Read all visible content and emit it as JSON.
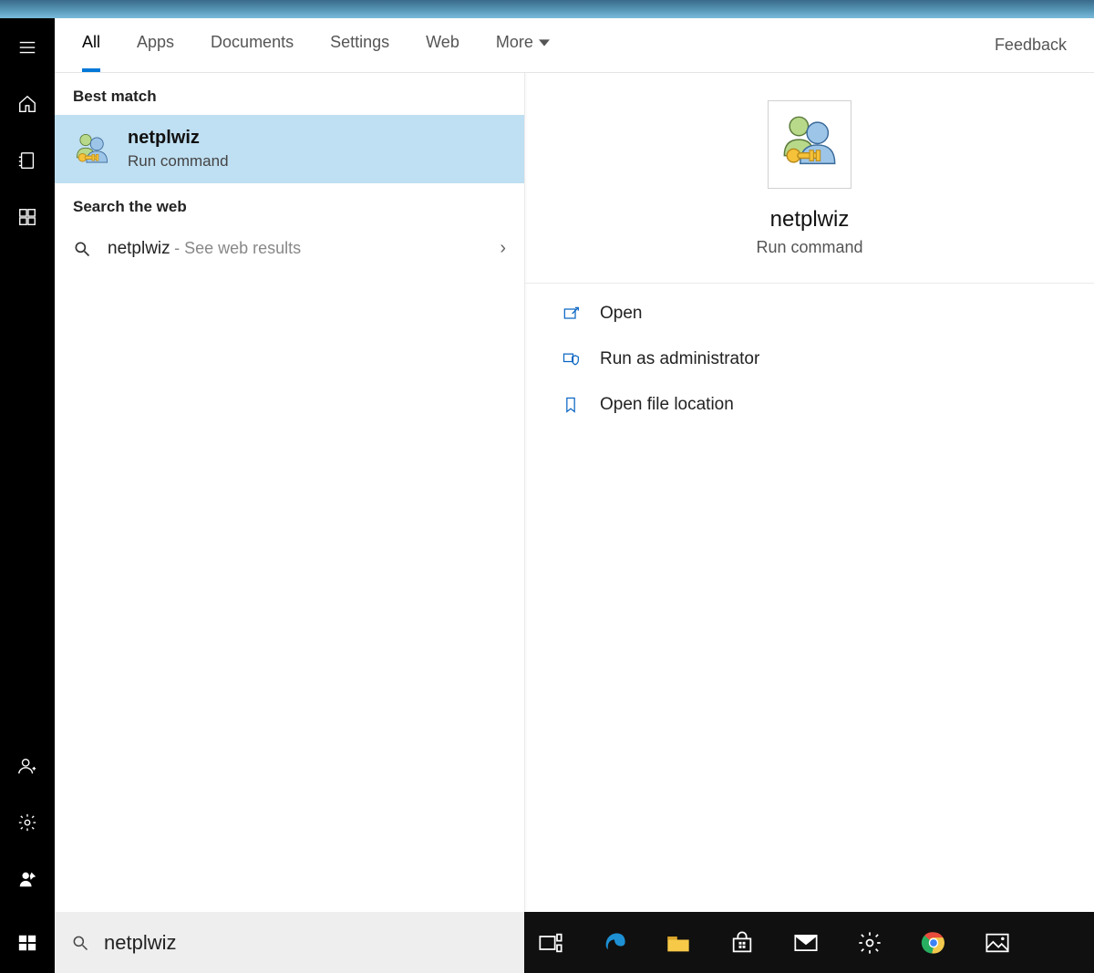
{
  "tabs": {
    "items": [
      "All",
      "Apps",
      "Documents",
      "Settings",
      "Web",
      "More"
    ],
    "feedback": "Feedback"
  },
  "sections": {
    "best_match": "Best match",
    "search_web": "Search the web"
  },
  "best_match": {
    "title": "netplwiz",
    "subtitle": "Run command"
  },
  "web_result": {
    "term": "netplwiz",
    "suffix": "- See web results"
  },
  "detail": {
    "title": "netplwiz",
    "subtitle": "Run command",
    "actions": {
      "open": "Open",
      "run_admin": "Run as administrator",
      "open_loc": "Open file location"
    }
  },
  "search": {
    "value": "netplwiz"
  }
}
